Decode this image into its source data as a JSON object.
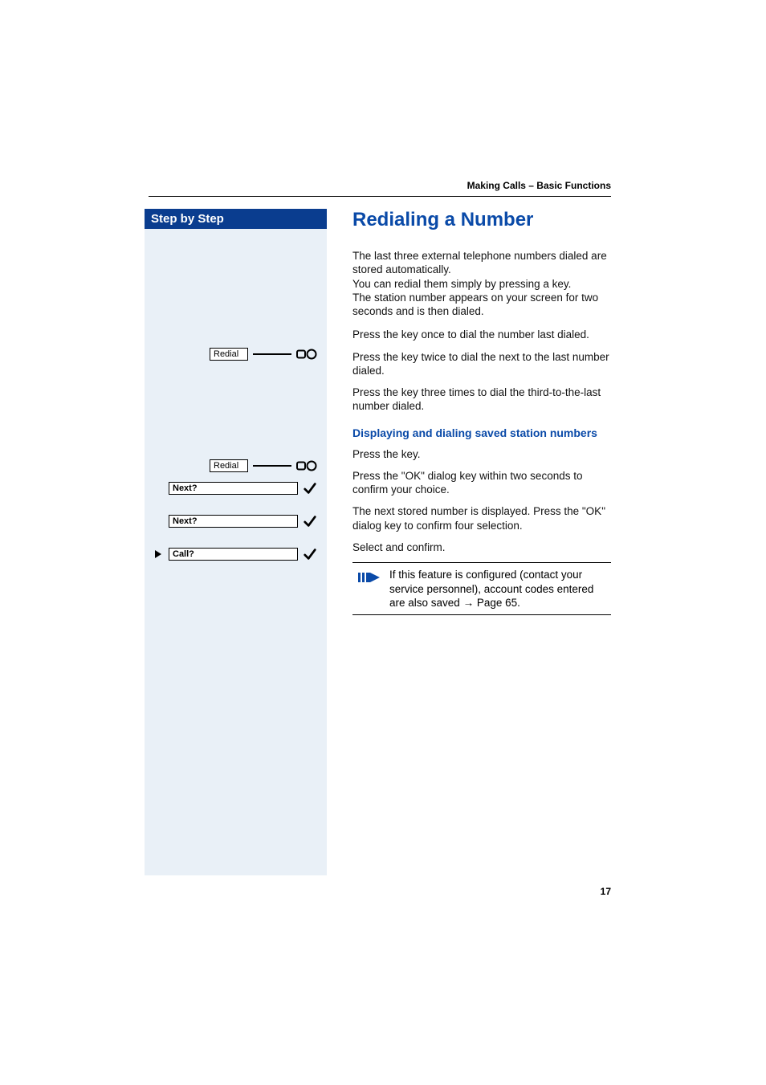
{
  "running_head": "Making Calls – Basic Functions",
  "sidebar": {
    "banner": "Step by Step",
    "row_redial_1": "Redial",
    "row_redial_2": "Redial",
    "row_next_1": "Next?",
    "row_next_2": "Next?",
    "row_call": "Call?"
  },
  "main": {
    "title": "Redialing a Number",
    "p1a": "The last three external telephone numbers dialed are stored automatically.",
    "p1b": "You can redial them simply by pressing a key.",
    "p1c": "The station number appears on your screen for two seconds and is then dialed.",
    "p2": "Press the key once to dial the number last dialed.",
    "p3": "Press the key twice to dial the next to the last number dialed.",
    "p4": "Press the key three times to dial the third-to-the-last number dialed.",
    "sub1": "Displaying and dialing saved station numbers",
    "p5": "Press the key.",
    "p6": "Press the \"OK\" dialog key within two seconds to confirm your choice.",
    "p7": "The next stored number is displayed. Press the \"OK\" dialog key to confirm four selection.",
    "p8": "Select and confirm.",
    "note_a": "If this feature is configured (contact your service personnel), account codes entered are also saved ",
    "note_arrow": "→",
    "note_b": " Page 65."
  },
  "page_number": "17"
}
